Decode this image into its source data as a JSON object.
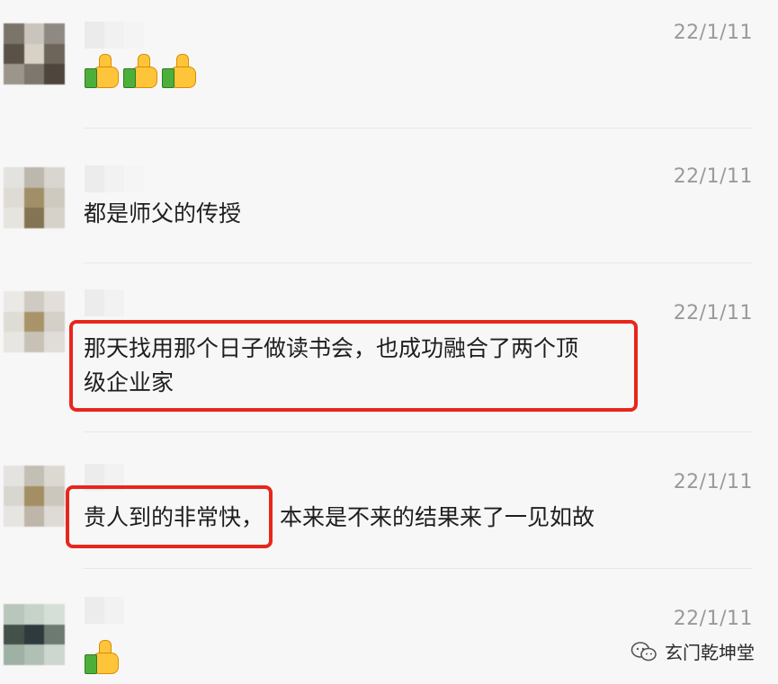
{
  "messages": [
    {
      "time": "22/1/11",
      "text": "",
      "emoji": [
        "thumbs-up",
        "thumbs-up",
        "thumbs-up"
      ]
    },
    {
      "time": "22/1/11",
      "text": "都是师父的传授"
    },
    {
      "time": "22/1/11",
      "text_line1": "那天找用那个日子做读书会，也成功融合了两个顶",
      "text_line2": "级企业家"
    },
    {
      "time": "22/1/11",
      "text_highlight": "贵人到的非常快，",
      "text_rest": "本来是不来的结果来了一见如故"
    },
    {
      "time": "22/1/11",
      "text": "",
      "emoji": [
        "thumbs-up"
      ]
    }
  ],
  "watermark": {
    "label": "玄门乾坤堂",
    "icon": "wechat-official-account-icon"
  },
  "colors": {
    "highlight_border": "#e8261c",
    "timestamp": "#9a9a9a",
    "background": "#f7f7f7"
  }
}
